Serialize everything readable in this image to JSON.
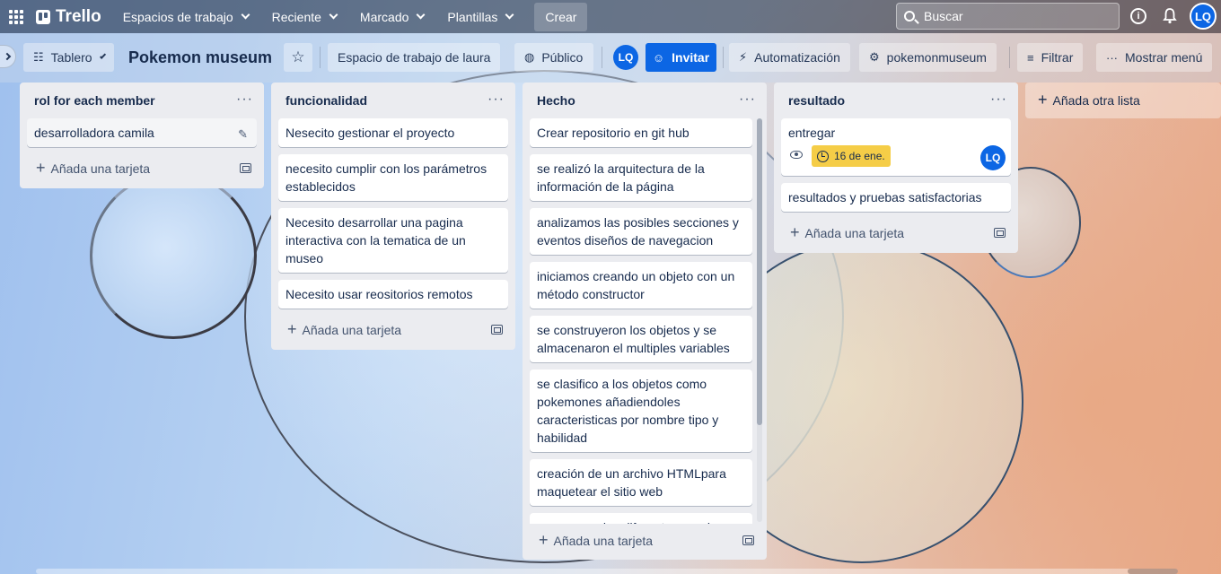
{
  "topnav": {
    "app_name": "Trello",
    "workspaces": "Espacios de trabajo",
    "recent": "Reciente",
    "starred": "Marcado",
    "templates": "Plantillas",
    "create": "Crear",
    "search_placeholder": "Buscar",
    "user_initials": "LQ"
  },
  "board": {
    "view": "Tablero",
    "title": "Pokemon museum",
    "workspace": "Espacio de trabajo de laura",
    "visibility": "Público",
    "member_initials": "LQ",
    "invite": "Invitar",
    "automation": "Automatización",
    "powerup": "pokemonmuseum",
    "filter": "Filtrar",
    "show_menu": "Mostrar menú"
  },
  "lists": [
    {
      "title": "rol for each member",
      "cards": [
        "desarrolladora camila"
      ],
      "add_card": "Añada una tarjeta"
    },
    {
      "title": "funcionalidad",
      "cards": [
        "Nesecito gestionar el proyecto",
        "necesito cumplir con los parámetros establecidos",
        "Necesito desarrollar una pagina interactiva con la tematica de un museo",
        "Necesito usar reositorios remotos"
      ],
      "add_card": "Añada una tarjeta"
    },
    {
      "title": "Hecho",
      "cards": [
        "Crear repositorio en git hub",
        "se realizó la arquitectura de la información de la página",
        "analizamos las posibles secciones y eventos diseños de navegacion",
        "iniciamos creando un objeto con un método constructor",
        "se construyeron los objetos y se almacenaron el multiples variables",
        "se clasifico a los objetos como pokemones añadiendoles caracteristicas por nombre tipo y habilidad",
        "creación de un archivo HTMLpara maquetear el sitio web",
        "agregamos las diferentes secciones"
      ],
      "add_card": "Añada una tarjeta"
    },
    {
      "title": "resultado",
      "cards": [
        "entregar",
        "resultados y pruebas satisfactorias"
      ],
      "due_date": "16 de ene.",
      "card_member": "LQ",
      "add_card": "Añada una tarjeta"
    }
  ],
  "add_list": "Añada otra lista",
  "icons": {
    "menu_dots": "···",
    "plus": "+",
    "star": "☆",
    "pencil": "✎",
    "lightning": "⚡",
    "gear": "⚙",
    "filter": "≡",
    "globe": "◍",
    "add_person": "☺"
  },
  "colors": {
    "invite_button": "#0c66e4",
    "due_badge": "#f5cd47",
    "list_bg": "#ebecf0"
  }
}
